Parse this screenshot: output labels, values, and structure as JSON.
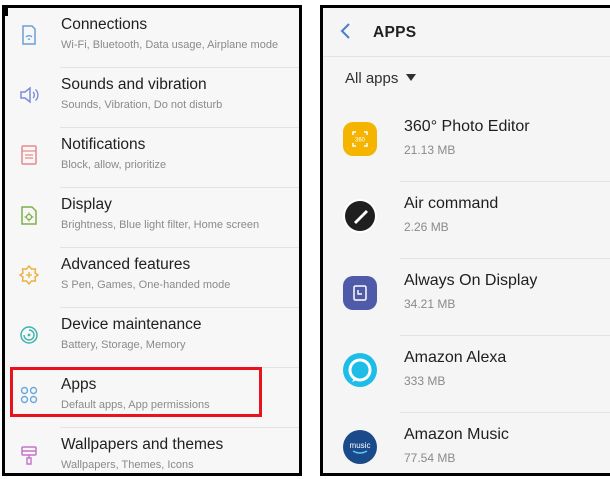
{
  "settings": {
    "items": [
      {
        "title": "Connections",
        "subtitle": "Wi-Fi, Bluetooth, Data usage, Airplane mode",
        "icon": "connections-icon"
      },
      {
        "title": "Sounds and vibration",
        "subtitle": "Sounds, Vibration, Do not disturb",
        "icon": "sound-icon"
      },
      {
        "title": "Notifications",
        "subtitle": "Block, allow, prioritize",
        "icon": "notifications-icon"
      },
      {
        "title": "Display",
        "subtitle": "Brightness, Blue light filter, Home screen",
        "icon": "display-icon"
      },
      {
        "title": "Advanced features",
        "subtitle": "S Pen, Games, One-handed mode",
        "icon": "advanced-features-icon"
      },
      {
        "title": "Device maintenance",
        "subtitle": "Battery, Storage, Memory",
        "icon": "device-maintenance-icon"
      },
      {
        "title": "Apps",
        "subtitle": "Default apps, App permissions",
        "icon": "apps-icon"
      },
      {
        "title": "Wallpapers and themes",
        "subtitle": "Wallpapers, Themes, Icons",
        "icon": "wallpapers-icon"
      }
    ],
    "highlighted": "Apps",
    "highlight_color": "#e8141c"
  },
  "apps_screen": {
    "title": "APPS",
    "filter": "All apps",
    "apps": [
      {
        "name": "360° Photo Editor",
        "size": "21.13 MB",
        "icon": "photo-editor-360-icon",
        "color": "#f4b400"
      },
      {
        "name": "Air command",
        "size": "2.26 MB",
        "icon": "air-command-icon",
        "color": "#1f1f1f"
      },
      {
        "name": "Always On Display",
        "size": "34.21 MB",
        "icon": "always-on-display-icon",
        "color": "#4f5aa8"
      },
      {
        "name": "Amazon Alexa",
        "size": "333 MB",
        "icon": "amazon-alexa-icon",
        "color": "#1ebde8"
      },
      {
        "name": "Amazon Music",
        "size": "77.54 MB",
        "icon": "amazon-music-icon",
        "color": "#1a4a8a"
      }
    ]
  }
}
